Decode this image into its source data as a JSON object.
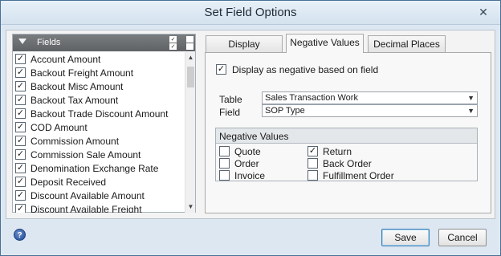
{
  "window": {
    "title": "Set Field Options",
    "close_glyph": "✕"
  },
  "fields_panel": {
    "header_label": "Fields",
    "items": [
      {
        "label": "Account Amount",
        "checked": true
      },
      {
        "label": "Backout Freight Amount",
        "checked": true
      },
      {
        "label": "Backout Misc Amount",
        "checked": true
      },
      {
        "label": "Backout Tax Amount",
        "checked": true
      },
      {
        "label": "Backout Trade Discount Amount",
        "checked": true
      },
      {
        "label": "COD Amount",
        "checked": true
      },
      {
        "label": "Commission Amount",
        "checked": true
      },
      {
        "label": "Commission Sale Amount",
        "checked": true
      },
      {
        "label": "Denomination Exchange Rate",
        "checked": true
      },
      {
        "label": "Deposit Received",
        "checked": true
      },
      {
        "label": "Discount Available Amount",
        "checked": true
      },
      {
        "label": "Discount Available Freight",
        "checked": true
      }
    ]
  },
  "tabs": [
    {
      "label": "Display",
      "active": false
    },
    {
      "label": "Negative Values",
      "active": true
    },
    {
      "label": "Decimal Places",
      "active": false
    }
  ],
  "negative_tab": {
    "display_negative_label": "Display as negative based on field",
    "display_negative_checked": true,
    "table_label": "Table",
    "table_value": "Sales Transaction Work",
    "field_label": "Field",
    "field_value": "SOP Type",
    "group_title": "Negative Values",
    "options": [
      {
        "label": "Quote",
        "checked": false
      },
      {
        "label": "Order",
        "checked": false
      },
      {
        "label": "Invoice",
        "checked": false
      },
      {
        "label": "Return",
        "checked": true
      },
      {
        "label": "Back Order",
        "checked": false
      },
      {
        "label": "Fulfillment Order",
        "checked": false
      }
    ]
  },
  "buttons": {
    "save": "Save",
    "cancel": "Cancel",
    "help": "?"
  },
  "check_glyph": "✓",
  "icons": {
    "help": "help-icon",
    "close": "close-icon",
    "collapse": "collapse-triangle-icon"
  }
}
